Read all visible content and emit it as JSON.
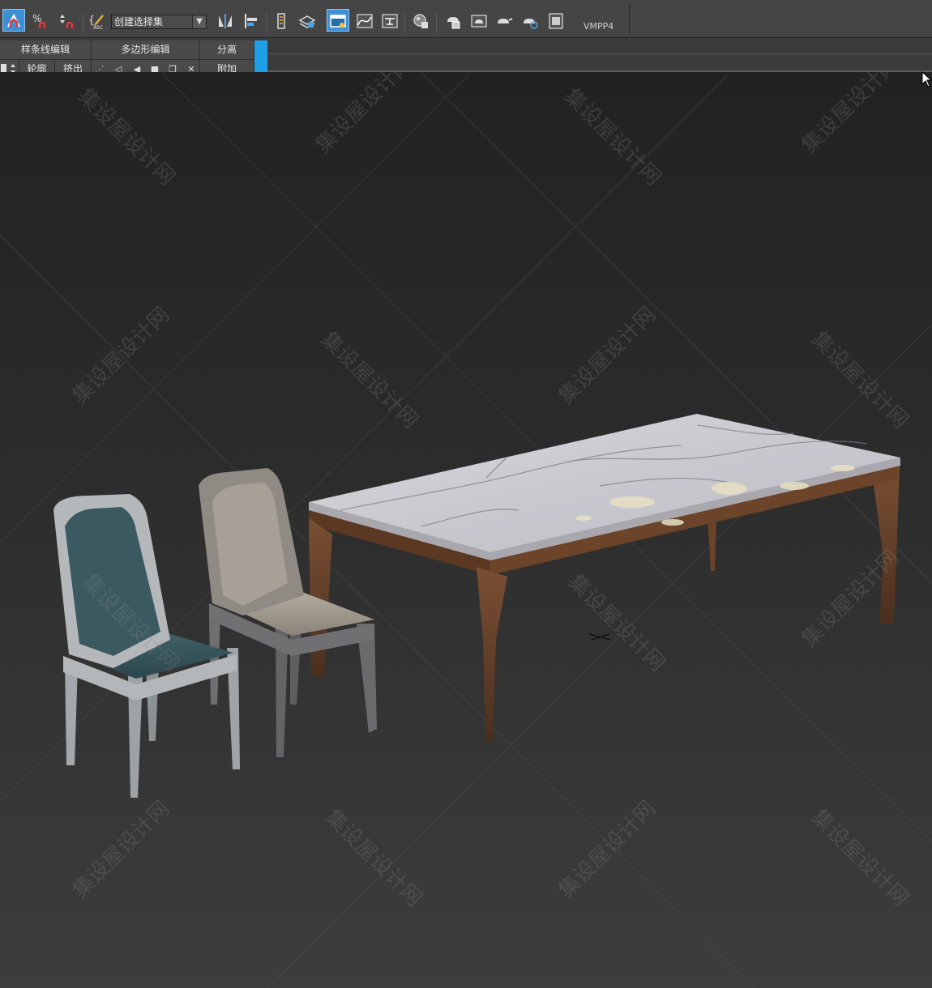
{
  "toolbar": {
    "selection_set": {
      "value": "创建选择集"
    },
    "vmpp_label": "VMPP4",
    "icons": [
      "snap-toggle-icon",
      "percent-snap-icon",
      "spinner-snap-icon",
      "edit-named-selection-icon",
      "mirror-icon",
      "align-icon",
      "layer-explorer-icon",
      "scene-explorer-icon",
      "toggle-ribbon-icon",
      "curve-editor-icon",
      "schematic-view-icon",
      "material-editor-icon",
      "render-setup-icon",
      "rendered-frame-icon",
      "render-production-icon",
      "render-iterative-icon",
      "render-cloud-icon",
      "render-window-icon"
    ]
  },
  "ribbon": {
    "row1": {
      "spline_edit": "样条线编辑",
      "poly_edit": "多边形编辑",
      "detach": "分离"
    },
    "row2": {
      "outline": "轮廓",
      "extrude": "挤出",
      "attach": "附加"
    }
  },
  "viewport": {
    "watermark": "集设屋设计网",
    "colors": {
      "background_top": "#222222",
      "background_bottom": "#3d3d3d",
      "accent": "#1e9fe6"
    }
  }
}
